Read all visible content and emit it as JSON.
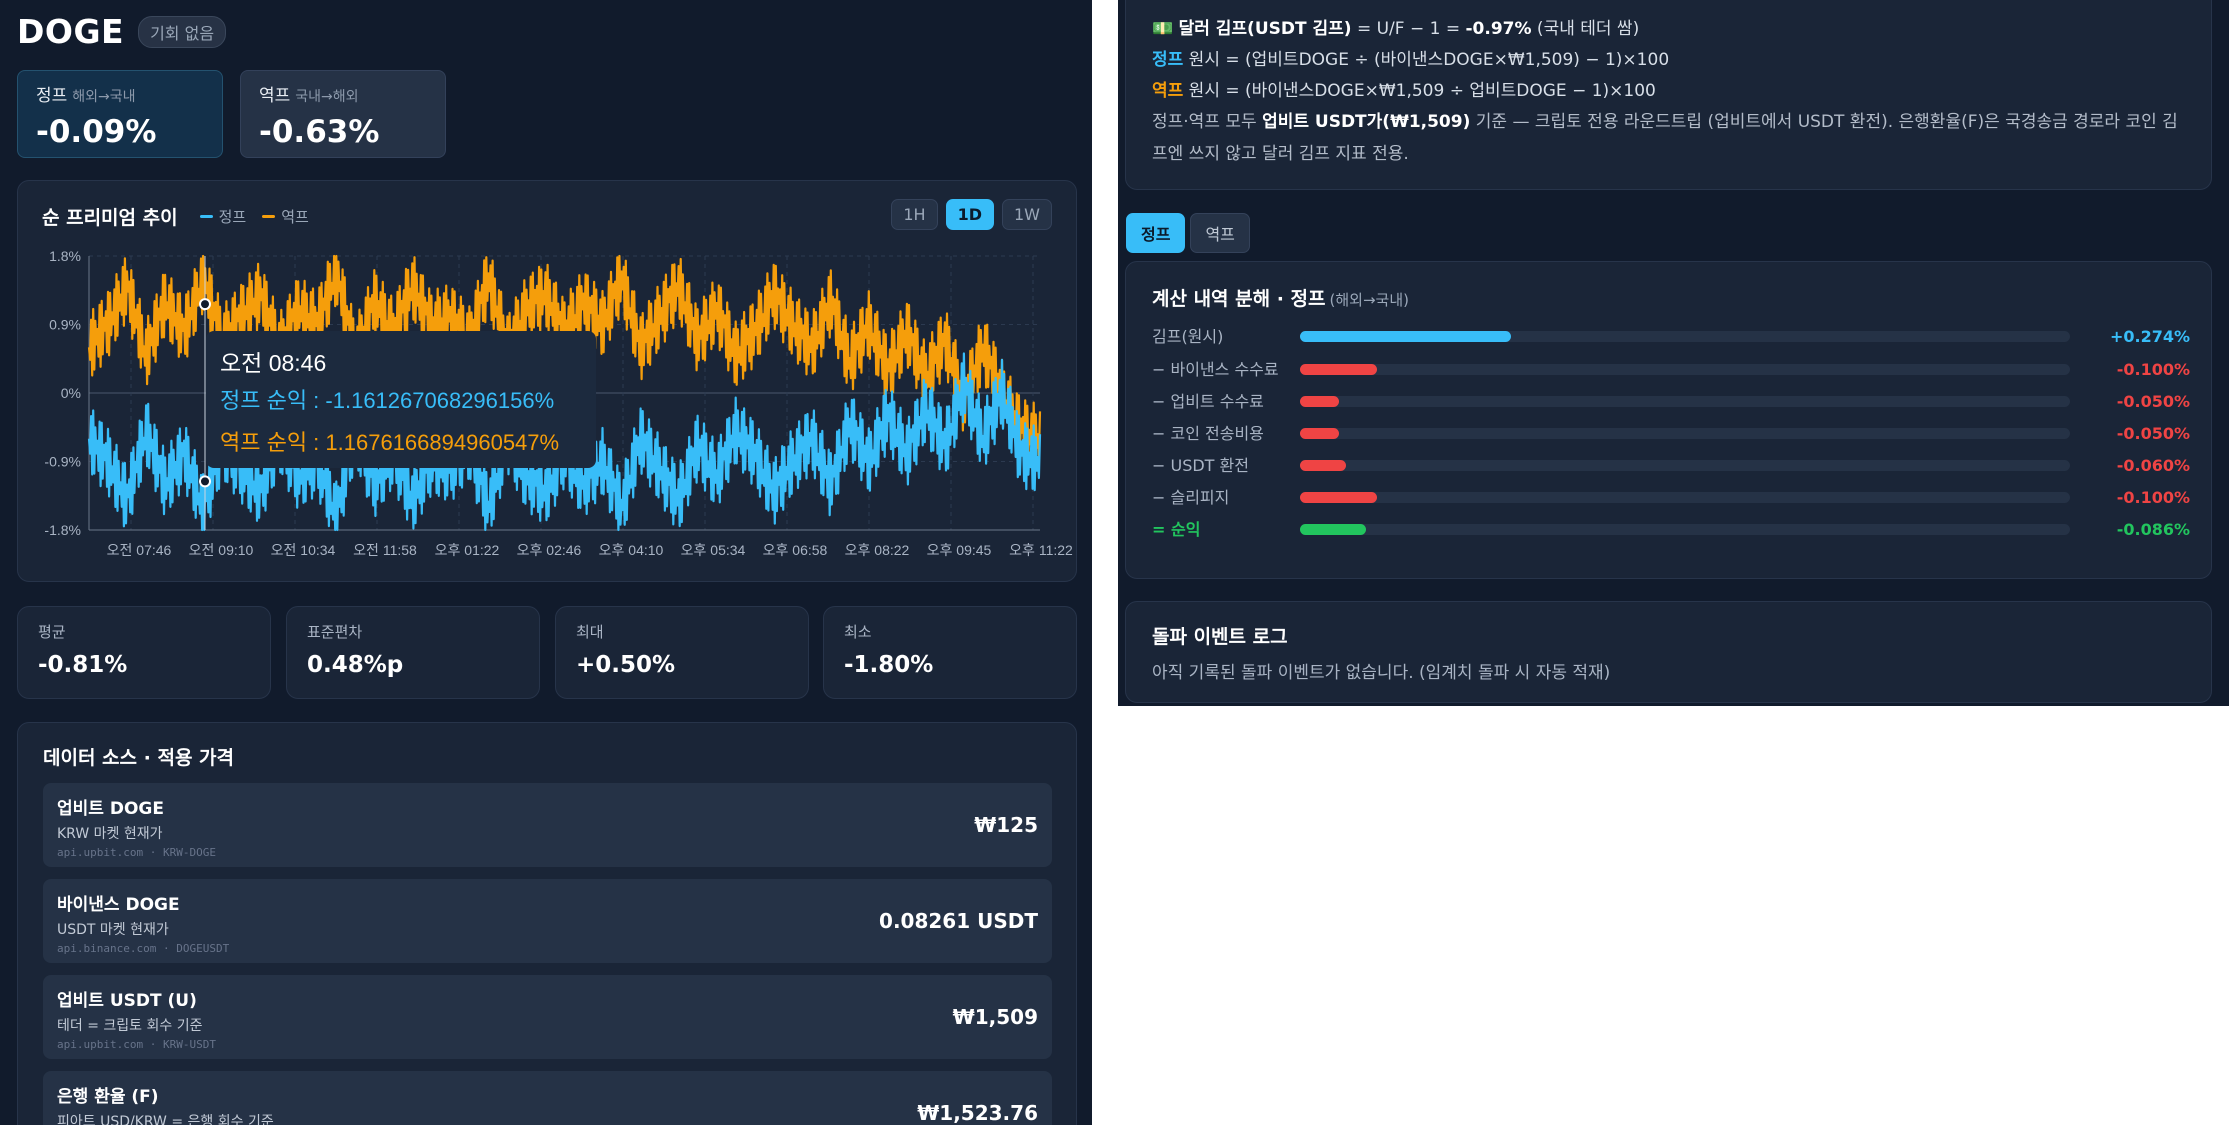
{
  "header": {
    "coin": "DOGE",
    "badge": "기회 없음"
  },
  "kpis": [
    {
      "title": "정프",
      "sub": "해외→국내",
      "value": "-0.09%"
    },
    {
      "title": "역프",
      "sub": "국내→해외",
      "value": "-0.63%"
    }
  ],
  "chart_panel": {
    "title": "순 프리미엄 추이",
    "legend": [
      "정프",
      "역프"
    ],
    "timeframes": [
      "1H",
      "1D",
      "1W"
    ],
    "active_timeframe": "1D",
    "tooltip": {
      "time": "오전 08:46",
      "line1": "정프 순익 : -1.161267068296156%",
      "line2": "역프 순익 : 1.1676166894960547%"
    }
  },
  "chart_data": {
    "type": "line",
    "x_ticks": [
      "오전 07:46",
      "오전 09:10",
      "오전 10:34",
      "오전 11:58",
      "오후 01:22",
      "오후 02:46",
      "오후 04:10",
      "오후 05:34",
      "오후 06:58",
      "오후 08:22",
      "오후 09:45",
      "오후 11:22"
    ],
    "y_ticks": [
      "1.8%",
      "0.9%",
      "0%",
      "-0.9%",
      "-1.8%"
    ],
    "ylim": [
      -1.8,
      1.8
    ],
    "grid": true,
    "series": [
      {
        "name": "정프",
        "color": "#38bdf8",
        "values": [
          -0.6,
          -0.9,
          -1.4,
          -0.5,
          -1.2,
          -0.8,
          -1.5,
          -0.7,
          -1.0,
          -1.3,
          -0.6,
          -1.1,
          -0.9,
          -1.6,
          -0.5,
          -1.2,
          -0.8,
          -1.4,
          -0.9,
          -1.0,
          -0.7,
          -1.5,
          -0.6,
          -1.1,
          -1.3,
          -0.8,
          -1.2,
          -0.9,
          -1.5,
          -0.6,
          -1.0,
          -1.4,
          -0.7,
          -1.1,
          -0.5,
          -0.8,
          -1.3,
          -0.9,
          -0.6,
          -1.2,
          -0.4,
          -0.9,
          -0.3,
          -0.8,
          -0.2,
          -0.7,
          0.1,
          -0.6,
          0.0,
          -0.8,
          -0.9
        ]
      },
      {
        "name": "역프",
        "color": "#f59e0b",
        "values": [
          0.6,
          0.9,
          1.4,
          0.5,
          1.2,
          0.8,
          1.5,
          0.7,
          1.0,
          1.3,
          0.6,
          1.1,
          0.9,
          1.6,
          0.5,
          1.2,
          0.8,
          1.4,
          0.9,
          1.0,
          0.7,
          1.5,
          0.6,
          1.1,
          1.3,
          0.8,
          1.2,
          0.9,
          1.5,
          0.6,
          1.0,
          1.4,
          0.7,
          1.1,
          0.5,
          0.8,
          1.3,
          0.9,
          0.6,
          1.2,
          0.4,
          0.9,
          0.3,
          0.8,
          0.2,
          0.7,
          -0.1,
          0.6,
          0.0,
          -0.5,
          -0.6
        ]
      }
    ]
  },
  "stats": [
    {
      "label": "평균",
      "value": "-0.81%"
    },
    {
      "label": "표준편차",
      "value": "0.48%p"
    },
    {
      "label": "최대",
      "value": "+0.50%"
    },
    {
      "label": "최소",
      "value": "-1.80%"
    }
  ],
  "data_source": {
    "title": "데이터 소스 · 적용 가격",
    "rows": [
      {
        "name": "업비트 DOGE",
        "desc": "KRW 마켓 현재가",
        "src": "api.upbit.com · KRW-DOGE",
        "price": "₩125"
      },
      {
        "name": "바이낸스 DOGE",
        "desc": "USDT 마켓 현재가",
        "src": "api.binance.com · DOGEUSDT",
        "price": "0.08261 USDT"
      },
      {
        "name": "업비트 USDT (U)",
        "desc": "테더 = 크립토 회수 기준",
        "src": "api.upbit.com · KRW-USDT",
        "price": "₩1,509"
      },
      {
        "name": "은행 환율 (F)",
        "desc": "피아트 USD/KRW = 은행 회수 기준",
        "src": "",
        "price": "₩1,523.76"
      }
    ]
  },
  "formulas": {
    "line1_icon": "💵",
    "line1_bold": "달러 김프(USDT 김프)",
    "line1_rest": " = U/F − 1 = ",
    "line1_value": "-0.97%",
    "line1_tail": " (국내 테더 쌈)",
    "line2_tag": "정프",
    "line2_rest": " 원시 = (업비트DOGE ÷ (바이낸스DOGE×₩1,509) − 1)×100",
    "line3_tag": "역프",
    "line3_rest": " 원시 = (바이낸스DOGE×₩1,509 ÷ 업비트DOGE − 1)×100",
    "note_pre": "정프·역프 모두 ",
    "note_bold": "업비트 USDT가(₩1,509)",
    "note_post": " 기준 — 크립토 전용 라운드트립 (업비트에서 USDT 환전). 은행환율(F)은 국경송금 경로라 코인 김프엔 쓰지 않고 달러 김프 지표 전용."
  },
  "segment": {
    "tabs": [
      "정프",
      "역프"
    ],
    "active": "정프"
  },
  "breakdown": {
    "title": "계산 내역 분해 · 정프",
    "subtitle": "(해외→국내)",
    "rows": [
      {
        "label": "김프(원시)",
        "value": "+0.274%",
        "fraction": 0.274,
        "color": "#38bdf8",
        "net": false
      },
      {
        "label": "− 바이낸스 수수료",
        "value": "-0.100%",
        "fraction": 0.1,
        "color": "#ef4444",
        "net": false
      },
      {
        "label": "− 업비트 수수료",
        "value": "-0.050%",
        "fraction": 0.05,
        "color": "#ef4444",
        "net": false
      },
      {
        "label": "− 코인 전송비용",
        "value": "-0.050%",
        "fraction": 0.05,
        "color": "#ef4444",
        "net": false
      },
      {
        "label": "− USDT 환전",
        "value": "-0.060%",
        "fraction": 0.06,
        "color": "#ef4444",
        "net": false
      },
      {
        "label": "− 슬리피지",
        "value": "-0.100%",
        "fraction": 0.1,
        "color": "#ef4444",
        "net": false
      },
      {
        "label": "= 순익",
        "value": "-0.086%",
        "fraction": 0.086,
        "color": "#22c55e",
        "net": true
      }
    ]
  },
  "events": {
    "title": "돌파 이벤트 로그",
    "empty": "아직 기록된 돌파 이벤트가 없습니다. (임계치 돌파 시 자동 적재)"
  }
}
